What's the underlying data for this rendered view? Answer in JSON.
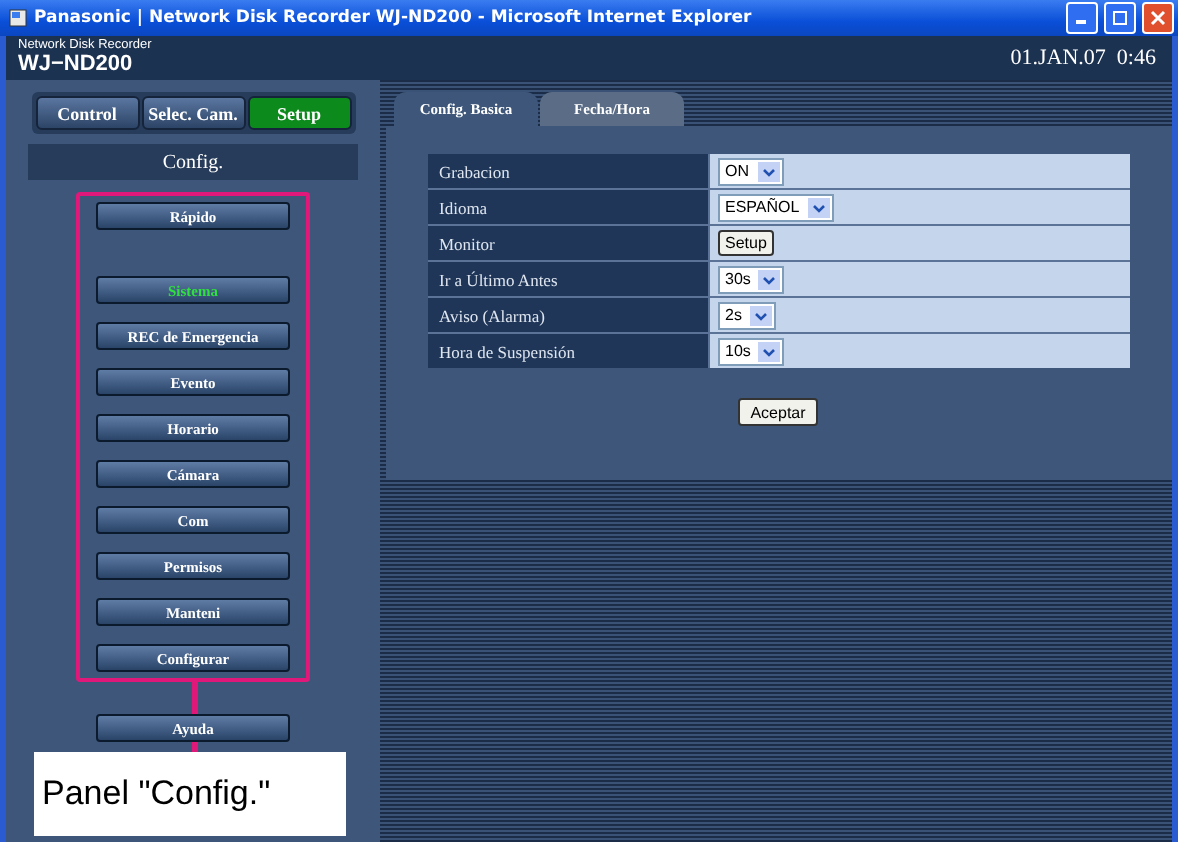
{
  "window": {
    "title": "Panasonic | Network Disk Recorder WJ-ND200 - Microsoft Internet Explorer"
  },
  "header": {
    "subtitle": "Network Disk Recorder",
    "model": "WJ−ND200",
    "datetime": "01.JAN.07  0:46"
  },
  "mode_tabs": [
    {
      "label": "Control",
      "selected": false
    },
    {
      "label": "Selec. Cam.",
      "selected": false
    },
    {
      "label": "Setup",
      "selected": true
    }
  ],
  "config_panel": {
    "heading": "Config.",
    "items": [
      {
        "label": "Rápido",
        "selected": false,
        "kind": "quick"
      },
      {
        "label": "Sistema",
        "selected": true,
        "kind": "section"
      },
      {
        "label": "REC de Emergencia",
        "selected": false,
        "kind": "section"
      },
      {
        "label": "Evento",
        "selected": false,
        "kind": "section"
      },
      {
        "label": "Horario",
        "selected": false,
        "kind": "section"
      },
      {
        "label": "Cámara",
        "selected": false,
        "kind": "section"
      },
      {
        "label": "Com",
        "selected": false,
        "kind": "section"
      },
      {
        "label": "Permisos",
        "selected": false,
        "kind": "section"
      },
      {
        "label": "Manteni",
        "selected": false,
        "kind": "section"
      },
      {
        "label": "Configurar",
        "selected": false,
        "kind": "section"
      }
    ],
    "help": "Ayuda"
  },
  "callout": "Panel \"Config.\"",
  "settings_tabs": [
    {
      "label": "Config. Basica",
      "selected": true
    },
    {
      "label": "Fecha/Hora",
      "selected": false
    }
  ],
  "settings": [
    {
      "label": "Grabacion",
      "kind": "select",
      "value": "ON"
    },
    {
      "label": "Idioma",
      "kind": "select",
      "value": "ESPAÑOL"
    },
    {
      "label": "Monitor",
      "kind": "button",
      "value": "Setup"
    },
    {
      "label": "Ir a Último Antes",
      "kind": "select",
      "value": "30s"
    },
    {
      "label": "Aviso (Alarma)",
      "kind": "select",
      "value": "2s"
    },
    {
      "label": "Hora de Suspensión",
      "kind": "select",
      "value": "10s"
    }
  ],
  "accept_button": "Aceptar"
}
